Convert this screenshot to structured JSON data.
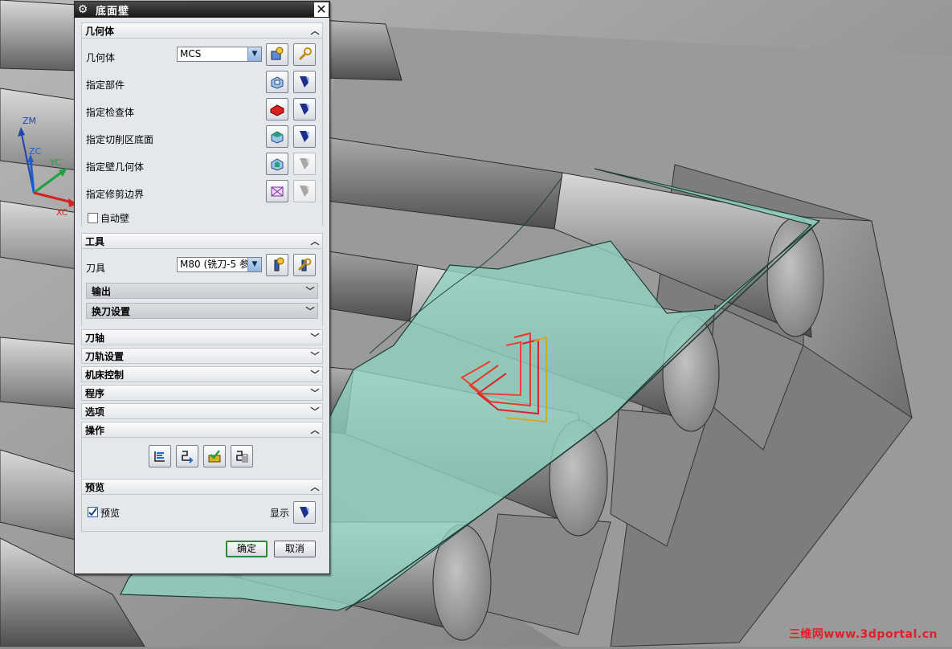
{
  "dialog": {
    "title": "底面壁",
    "sections": {
      "geometry": "几何体",
      "tool": "工具",
      "tool_axis": "刀轴",
      "path_settings": "刀轨设置",
      "machine_control": "机床控制",
      "program": "程序",
      "options": "选项",
      "actions": "操作",
      "preview": "预览"
    },
    "geometry": {
      "geometry_label": "几何体",
      "geometry_value": "MCS",
      "specify_part": "指定部件",
      "specify_check": "指定检查体",
      "specify_floor": "指定切削区底面",
      "specify_wall": "指定壁几何体",
      "specify_trim": "指定修剪边界",
      "auto_wall": "自动壁"
    },
    "tool": {
      "tool_label": "刀具",
      "tool_value": "M80 (铣刀-5 参",
      "output": "输出",
      "tool_change": "换刀设置"
    },
    "preview": {
      "preview_label": "预览",
      "show_label": "显示",
      "preview_checked": true
    },
    "ok": "确定",
    "cancel": "取消"
  },
  "axes": {
    "zm": "ZM",
    "zc": "ZC",
    "yc": "YC",
    "xc": "XC"
  },
  "watermark": "三维网www.3dportal.cn",
  "colors": {
    "surface": "#8fd1bf",
    "model": "#9a9a9a",
    "toolpath": "#e33a2a",
    "accent": "#2f8a2f"
  }
}
